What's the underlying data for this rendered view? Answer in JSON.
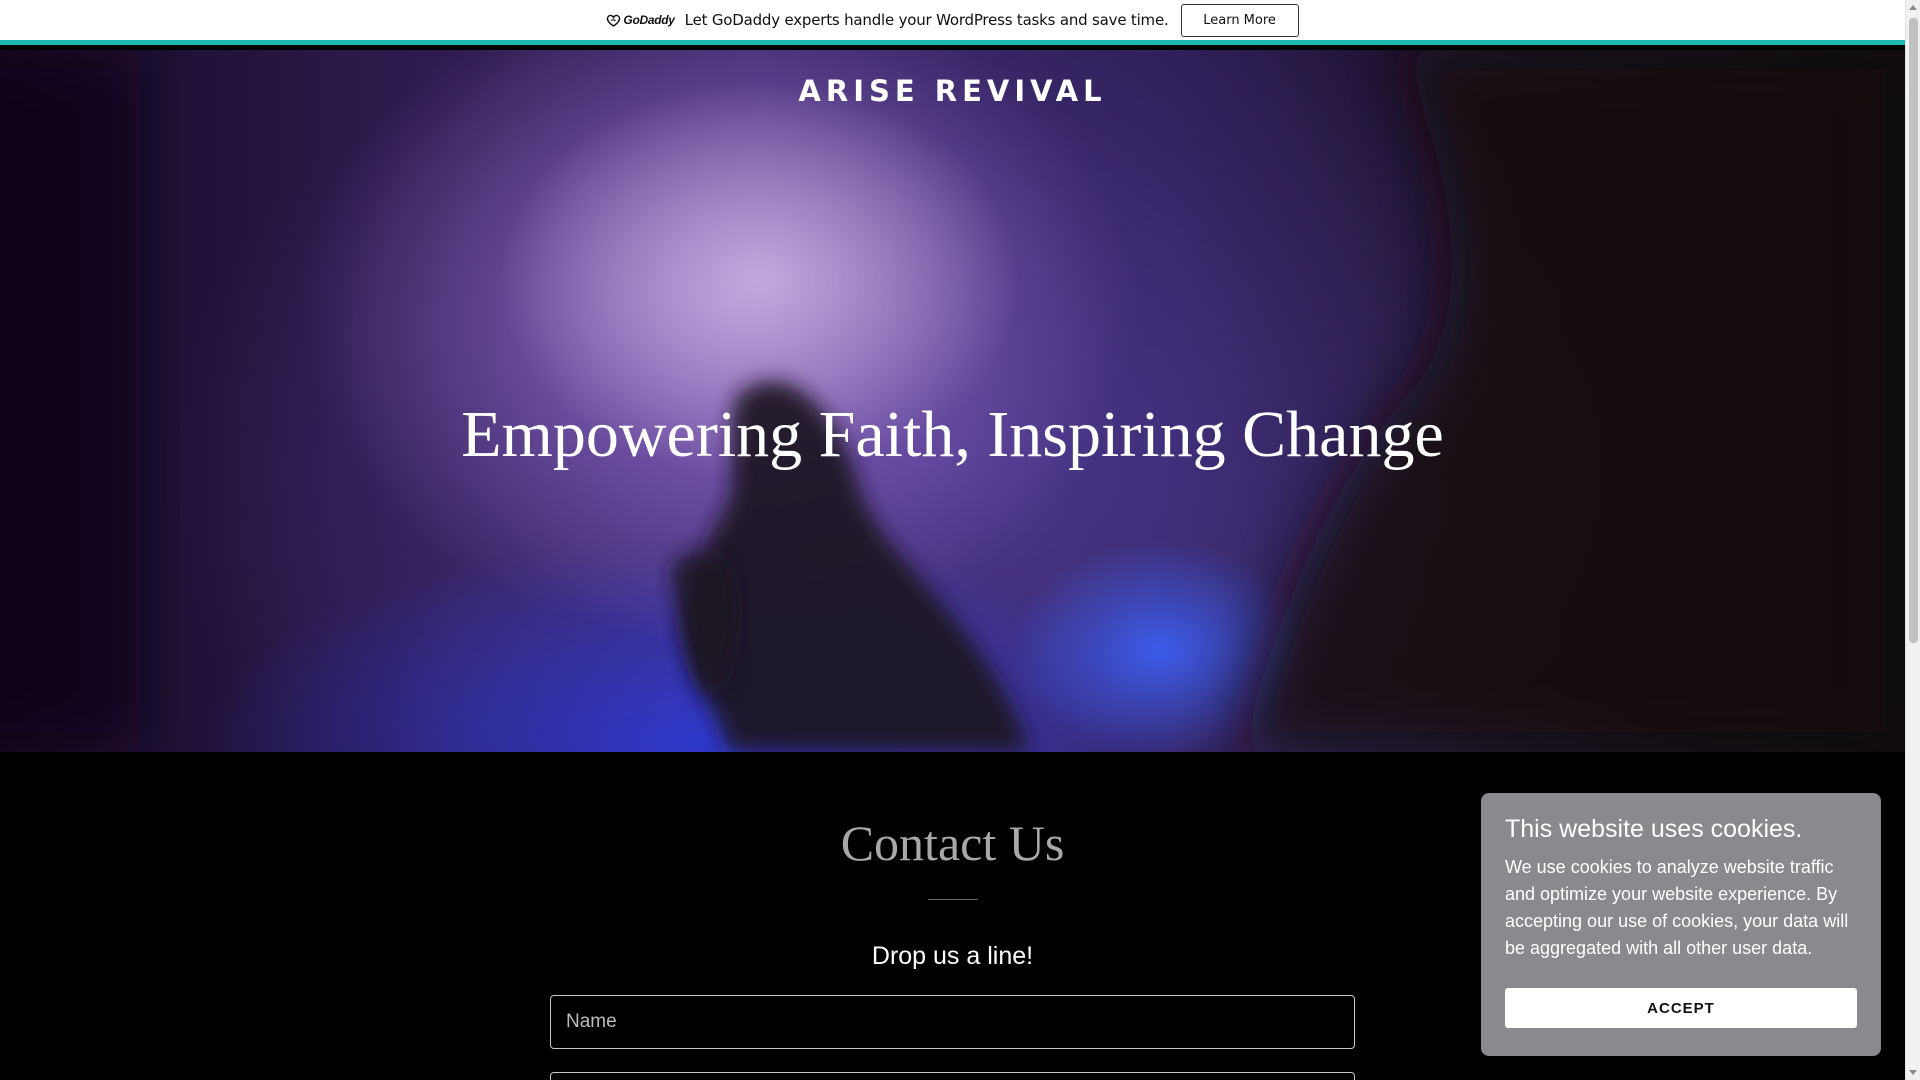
{
  "banner": {
    "logo_text": "GoDaddy",
    "message": "Let GoDaddy experts handle your WordPress tasks and save time.",
    "button_label": "Learn More",
    "accent_color": "#1bb7b0"
  },
  "site": {
    "title": "ARISE REVIVAL"
  },
  "hero": {
    "heading": "Empowering Faith, Inspiring Change"
  },
  "contact": {
    "title": "Contact Us",
    "subtitle": "Drop us a line!",
    "name_placeholder": "Name"
  },
  "cookie": {
    "title": "This website uses cookies.",
    "body": "We use cookies to analyze website traffic and optimize your website experience. By accepting our use of cookies, your data will be aggregated with all other user data.",
    "accept_label": "ACCEPT"
  }
}
